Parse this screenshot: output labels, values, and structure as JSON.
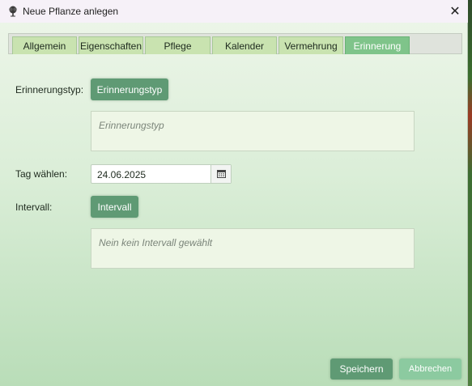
{
  "window": {
    "title": "Neue Pflanze anlegen",
    "close_glyph": "✕",
    "app_icon": "tree-icon"
  },
  "tabs": [
    {
      "label": "Allgemein",
      "active": false
    },
    {
      "label": "Eigenschaften",
      "active": false
    },
    {
      "label": "Pflege",
      "active": false
    },
    {
      "label": "Kalender",
      "active": false
    },
    {
      "label": "Vermehrung",
      "active": false
    },
    {
      "label": "Erinnerung",
      "active": true
    }
  ],
  "form": {
    "reminder_type_label": "Erinnerungstyp:",
    "reminder_type_button": "Erinnerungstyp",
    "reminder_type_placeholder": "Erinnerungstyp",
    "day_label": "Tag wählen:",
    "day_value": "24.06.2025",
    "calendar_icon": "calendar-icon",
    "interval_label": "Intervall:",
    "interval_button": "Intervall",
    "interval_placeholder": "Nein kein Intervall gewählt"
  },
  "footer": {
    "save_label": "Speichern",
    "cancel_label": "Abbrechen"
  },
  "colors": {
    "accent": "#5f9a74",
    "active_tab": "#7fc48a",
    "tab": "#c9e3b0"
  }
}
